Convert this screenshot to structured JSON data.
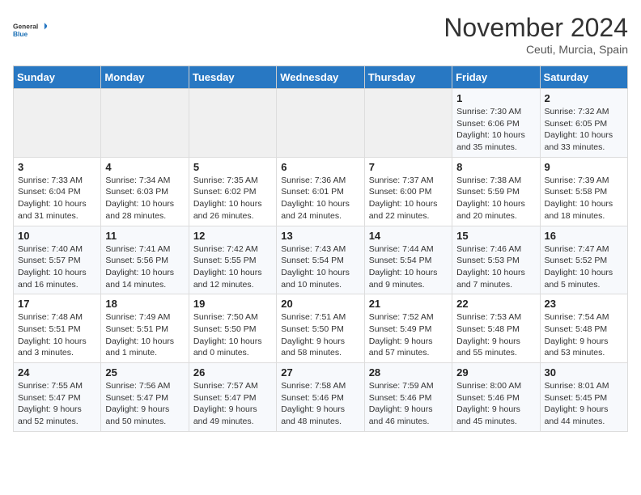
{
  "header": {
    "logo_general": "General",
    "logo_blue": "Blue",
    "month": "November 2024",
    "location": "Ceuti, Murcia, Spain"
  },
  "weekdays": [
    "Sunday",
    "Monday",
    "Tuesday",
    "Wednesday",
    "Thursday",
    "Friday",
    "Saturday"
  ],
  "weeks": [
    [
      {
        "day": "",
        "info": ""
      },
      {
        "day": "",
        "info": ""
      },
      {
        "day": "",
        "info": ""
      },
      {
        "day": "",
        "info": ""
      },
      {
        "day": "",
        "info": ""
      },
      {
        "day": "1",
        "info": "Sunrise: 7:30 AM\nSunset: 6:06 PM\nDaylight: 10 hours\nand 35 minutes."
      },
      {
        "day": "2",
        "info": "Sunrise: 7:32 AM\nSunset: 6:05 PM\nDaylight: 10 hours\nand 33 minutes."
      }
    ],
    [
      {
        "day": "3",
        "info": "Sunrise: 7:33 AM\nSunset: 6:04 PM\nDaylight: 10 hours\nand 31 minutes."
      },
      {
        "day": "4",
        "info": "Sunrise: 7:34 AM\nSunset: 6:03 PM\nDaylight: 10 hours\nand 28 minutes."
      },
      {
        "day": "5",
        "info": "Sunrise: 7:35 AM\nSunset: 6:02 PM\nDaylight: 10 hours\nand 26 minutes."
      },
      {
        "day": "6",
        "info": "Sunrise: 7:36 AM\nSunset: 6:01 PM\nDaylight: 10 hours\nand 24 minutes."
      },
      {
        "day": "7",
        "info": "Sunrise: 7:37 AM\nSunset: 6:00 PM\nDaylight: 10 hours\nand 22 minutes."
      },
      {
        "day": "8",
        "info": "Sunrise: 7:38 AM\nSunset: 5:59 PM\nDaylight: 10 hours\nand 20 minutes."
      },
      {
        "day": "9",
        "info": "Sunrise: 7:39 AM\nSunset: 5:58 PM\nDaylight: 10 hours\nand 18 minutes."
      }
    ],
    [
      {
        "day": "10",
        "info": "Sunrise: 7:40 AM\nSunset: 5:57 PM\nDaylight: 10 hours\nand 16 minutes."
      },
      {
        "day": "11",
        "info": "Sunrise: 7:41 AM\nSunset: 5:56 PM\nDaylight: 10 hours\nand 14 minutes."
      },
      {
        "day": "12",
        "info": "Sunrise: 7:42 AM\nSunset: 5:55 PM\nDaylight: 10 hours\nand 12 minutes."
      },
      {
        "day": "13",
        "info": "Sunrise: 7:43 AM\nSunset: 5:54 PM\nDaylight: 10 hours\nand 10 minutes."
      },
      {
        "day": "14",
        "info": "Sunrise: 7:44 AM\nSunset: 5:54 PM\nDaylight: 10 hours\nand 9 minutes."
      },
      {
        "day": "15",
        "info": "Sunrise: 7:46 AM\nSunset: 5:53 PM\nDaylight: 10 hours\nand 7 minutes."
      },
      {
        "day": "16",
        "info": "Sunrise: 7:47 AM\nSunset: 5:52 PM\nDaylight: 10 hours\nand 5 minutes."
      }
    ],
    [
      {
        "day": "17",
        "info": "Sunrise: 7:48 AM\nSunset: 5:51 PM\nDaylight: 10 hours\nand 3 minutes."
      },
      {
        "day": "18",
        "info": "Sunrise: 7:49 AM\nSunset: 5:51 PM\nDaylight: 10 hours\nand 1 minute."
      },
      {
        "day": "19",
        "info": "Sunrise: 7:50 AM\nSunset: 5:50 PM\nDaylight: 10 hours\nand 0 minutes."
      },
      {
        "day": "20",
        "info": "Sunrise: 7:51 AM\nSunset: 5:50 PM\nDaylight: 9 hours\nand 58 minutes."
      },
      {
        "day": "21",
        "info": "Sunrise: 7:52 AM\nSunset: 5:49 PM\nDaylight: 9 hours\nand 57 minutes."
      },
      {
        "day": "22",
        "info": "Sunrise: 7:53 AM\nSunset: 5:48 PM\nDaylight: 9 hours\nand 55 minutes."
      },
      {
        "day": "23",
        "info": "Sunrise: 7:54 AM\nSunset: 5:48 PM\nDaylight: 9 hours\nand 53 minutes."
      }
    ],
    [
      {
        "day": "24",
        "info": "Sunrise: 7:55 AM\nSunset: 5:47 PM\nDaylight: 9 hours\nand 52 minutes."
      },
      {
        "day": "25",
        "info": "Sunrise: 7:56 AM\nSunset: 5:47 PM\nDaylight: 9 hours\nand 50 minutes."
      },
      {
        "day": "26",
        "info": "Sunrise: 7:57 AM\nSunset: 5:47 PM\nDaylight: 9 hours\nand 49 minutes."
      },
      {
        "day": "27",
        "info": "Sunrise: 7:58 AM\nSunset: 5:46 PM\nDaylight: 9 hours\nand 48 minutes."
      },
      {
        "day": "28",
        "info": "Sunrise: 7:59 AM\nSunset: 5:46 PM\nDaylight: 9 hours\nand 46 minutes."
      },
      {
        "day": "29",
        "info": "Sunrise: 8:00 AM\nSunset: 5:46 PM\nDaylight: 9 hours\nand 45 minutes."
      },
      {
        "day": "30",
        "info": "Sunrise: 8:01 AM\nSunset: 5:45 PM\nDaylight: 9 hours\nand 44 minutes."
      }
    ]
  ]
}
